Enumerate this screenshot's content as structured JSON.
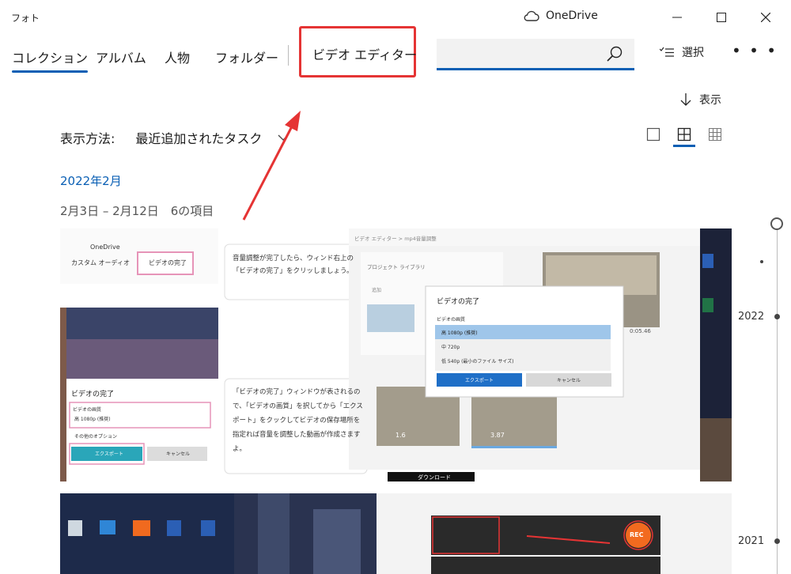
{
  "app": {
    "title": "フォト"
  },
  "titlebar": {
    "onedrive": "OneDrive"
  },
  "nav": {
    "items": [
      "コレクション",
      "アルバム",
      "人物",
      "フォルダー"
    ],
    "video_editor": "ビデオ エディター"
  },
  "search": {
    "placeholder": ""
  },
  "toolbar": {
    "select": "選択",
    "more": "• • •",
    "show": "表示"
  },
  "sortbar": {
    "label": "表示方法:",
    "value": "最近追加されたタスク"
  },
  "group": {
    "title": "2022年2月",
    "subtitle": "2月3日 – 2月12日　6の項目"
  },
  "timeline": {
    "years": [
      "2022",
      "2021"
    ]
  },
  "photo1": {
    "onedrive": "OneDrive",
    "custom_audio": "カスタム オーディオ",
    "finish_video": "ビデオの完了",
    "tip1": "音量調整が完了したら、ウィンド右上の「ビデオの完了」をクリッしましょう。",
    "dialog_title": "ビデオの完了",
    "quality_label": "ビデオの画質",
    "quality_value": "高 1080p (推奨)",
    "more_options": "その他のオプション",
    "export": "エクスポート",
    "cancel": "キャンセル",
    "tip2": "「ビデオの完了」ウィンドウが表されるので、「ビデオの画質」を択してから「エクスポート」をクックしてビデオの保存場所を指定れば音量を調整した動画が作成さますよ。",
    "editor_breadcrumb": "ビデオ エディター > mp4音量調整",
    "project_library": "プロジェクト ライブラリ",
    "add": "追加",
    "big_dialog_title": "ビデオの完了",
    "big_quality_label": "ビデオの画質",
    "options": [
      "高 1080p (推奨)",
      "中 720p",
      "低 540p (最小のファイル サイズ)"
    ],
    "big_export": "エクスポート",
    "big_cancel": "キャンセル",
    "clip1": "1.6",
    "clip2": "3.87",
    "time": "0:05.46",
    "download": "ダウンロード"
  },
  "photo2": {
    "rec": "REC"
  },
  "colors": {
    "accent": "#0a5fb4",
    "highlight": "#e53434"
  }
}
